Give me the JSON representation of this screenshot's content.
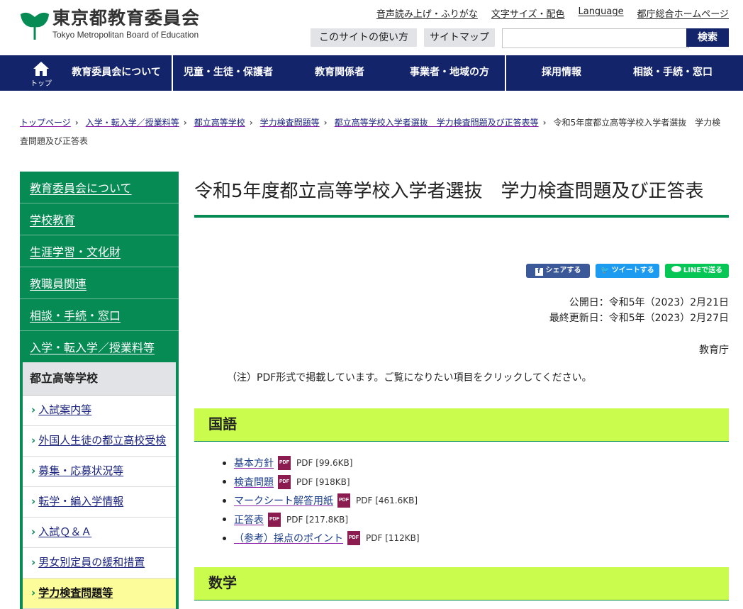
{
  "header": {
    "logo_title": "東京都教育委員会",
    "logo_subtitle": "Tokyo Metropolitan Board of Education",
    "brand_color": "#068b55",
    "util_links": [
      "音声読み上げ・ふりがな",
      "文字サイズ・配色",
      "Language",
      "都庁総合ホームページ"
    ],
    "usage_label": "このサイトの使い方",
    "sitemap_label": "サイトマップ",
    "search_placeholder": "",
    "search_label": "検索"
  },
  "nav": {
    "home_label": "トップ",
    "items": [
      "教育委員会について",
      "児童・生徒・保護者",
      "教育関係者",
      "事業者・地域の方",
      "採用情報",
      "相談・手続・窓口"
    ],
    "bg_color": "#13246b"
  },
  "breadcrumb": {
    "links": [
      "トップページ",
      "入学・転入学／授業料等",
      "都立高等学校",
      "学力検査問題等",
      "都立高等学校入学者選抜　学力検査問題及び正答表等"
    ],
    "current": "令和5年度都立高等学校入学者選抜　学力検査問題及び正答表"
  },
  "sidebar": {
    "top_items": [
      "教育委員会について",
      "学校教育",
      "生涯学習・文化財",
      "教職員関連",
      "相談・手続・窓口",
      "入学・転入学／授業料等"
    ],
    "section_title": "都立高等学校",
    "sub_items": [
      "入試案内等",
      "外国人生徒の都立高校受検",
      "募集・応募状況等",
      "転学・編入学情報",
      "入試Ｑ＆Ａ",
      "男女別定員の緩和措置",
      "学力検査問題等"
    ],
    "current_sub": "学力検査問題等"
  },
  "main": {
    "title": "令和5年度都立高等学校入学者選抜　学力検査問題及び正答表",
    "share": {
      "facebook": "シェアする",
      "twitter": "ツイートする",
      "line": "LINEで送る"
    },
    "published": "公開日：令和5年（2023）2月21日",
    "updated": "最終更新日：令和5年（2023）2月27日",
    "department": "教育庁",
    "note": "（注）PDF形式で掲載しています。ご覧になりたい項目をクリックしてください。",
    "pdf_label": "PDF",
    "sections": [
      {
        "title": "国語",
        "files": [
          {
            "name": "基本方針",
            "meta": "PDF [99.6KB]"
          },
          {
            "name": "検査問題",
            "meta": "PDF [918KB]"
          },
          {
            "name": "マークシート解答用紙",
            "meta": "PDF [461.6KB]"
          },
          {
            "name": "正答表",
            "meta": "PDF [217.8KB]"
          },
          {
            "name": "（参考）採点のポイント",
            "meta": "PDF [112KB]"
          }
        ]
      },
      {
        "title": "数学",
        "files": []
      }
    ]
  }
}
